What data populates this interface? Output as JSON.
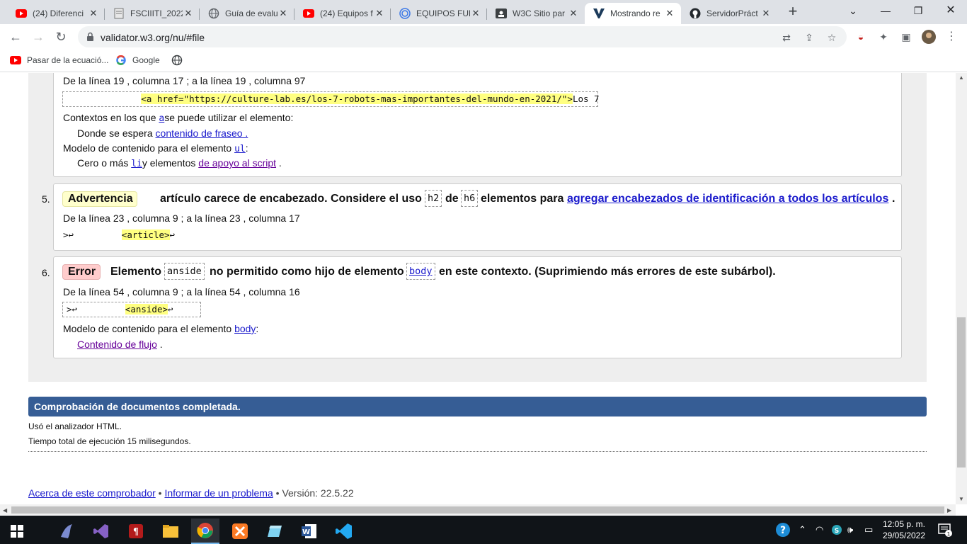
{
  "tabs": [
    {
      "title": "(24) Diferenci",
      "icon": "youtube-icon"
    },
    {
      "title": "FSCIIITI_2022",
      "icon": "doc-icon"
    },
    {
      "title": "Guía de evalu",
      "icon": "globe-icon"
    },
    {
      "title": "(24) Equipos f",
      "icon": "youtube-icon"
    },
    {
      "title": "EQUIPOS FUN",
      "icon": "target-icon"
    },
    {
      "title": "W3C Sitio par",
      "icon": "w3c-icon"
    },
    {
      "title": "Mostrando re",
      "icon": "validator-icon"
    },
    {
      "title": "ServidorPráct",
      "icon": "github-icon"
    }
  ],
  "toolbar": {
    "url": "validator.w3.org/nu/#file"
  },
  "bookmarks": [
    {
      "label": "Pasar de la ecuació...",
      "icon": "youtube-icon"
    },
    {
      "label": "Google",
      "icon": "google-icon"
    },
    {
      "label": "",
      "icon": "globe-icon"
    }
  ],
  "msg4": {
    "location": "De la línea 19 , columna 17 ; a la línea 19 , columna 97",
    "code": "<a href=\"https://culture-lab.es/los-7-robots-mas-importantes-del-mundo-en-2021/\">",
    "code_tail": "Los 7",
    "contexts_pre": "Contextos en los que ",
    "contexts_el": "a",
    "contexts_post": "se puede utilizar el elemento:",
    "contexts_value_pre": "Donde se espera ",
    "contexts_value_link": "contenido de fraseo",
    "contexts_value_post": " .",
    "model_pre": "Modelo de contenido para el elemento ",
    "model_el": "ul",
    "model_post": ":",
    "model_value_pre": "Cero o más ",
    "model_value_el": "li",
    "model_value_mid": "y elementos ",
    "model_value_link": "de apoyo al script",
    "model_value_post": " ."
  },
  "msg5": {
    "number": "5.",
    "badge": "Advertencia",
    "text_a": "artículo carece de encabezado. Considere el uso",
    "code_a": "h2",
    "text_b": "de",
    "code_b": "h6",
    "text_c": "elementos para",
    "link": "agregar encabezados de identificación a todos los artículos",
    "text_d": ".",
    "location": "De la línea 23 , columna 9 ; a la línea 23 , columna 17",
    "code_pre": ">↩",
    "code": "<article>",
    "code_post": "↩"
  },
  "msg6": {
    "number": "6.",
    "badge": "Error",
    "text_a": "Elemento",
    "code_a": "anside",
    "text_b": "no permitido como hijo de elemento",
    "code_b": "body",
    "text_c": "en este contexto. (Suprimiendo más errores de este subárbol).",
    "location": "De la línea 54 , columna 9 ; a la línea 54 , columna 16",
    "code_pre": ">↩",
    "code": "<anside>",
    "code_post": "↩",
    "model_pre": "Modelo de contenido para el elemento ",
    "model_el": "body",
    "model_post": ":",
    "model_value_link": "Contenido de flujo",
    "model_value_post": " ."
  },
  "summary": {
    "title": "Comprobación de documentos completada.",
    "parser": "Usó el analizador HTML.",
    "time": "Tiempo total de ejecución 15 milisegundos."
  },
  "footer": {
    "about": "Acerca de este comprobador",
    "sep1": " • ",
    "report": "Informar de un problema",
    "version": " • Versión: 22.5.22"
  },
  "clock": {
    "time": "12:05 p. m.",
    "date": "29/05/2022"
  },
  "colors": {
    "accent_blue": "#365d95",
    "warning_bg": "#ffffcc",
    "error_bg": "#ffcccc",
    "highlight": "#ffff80"
  }
}
